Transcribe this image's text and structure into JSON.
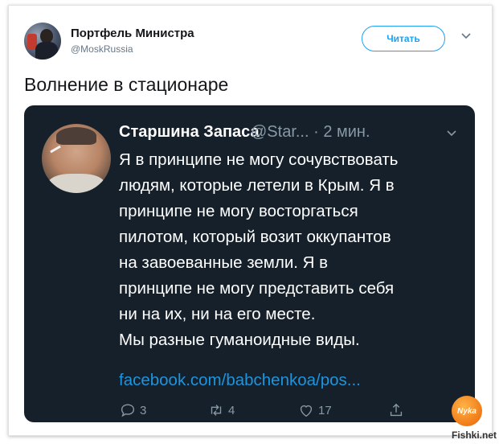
{
  "header": {
    "name": "Портфель Министра",
    "handle": "@MoskRussia",
    "follow_label": "Читать"
  },
  "tweet": {
    "text": "Волнение в стационаре"
  },
  "screenshot": {
    "name": "Старшина Запаса",
    "meta": "@Star... · 2 мин.",
    "body_lines": [
      "Я в принципе не могу сочувствовать",
      "людям, которые летели в Крым. Я в",
      "принципе не могу восторгаться",
      "пилотом, который возит оккупантов",
      "на завоеванные земли. Я в",
      "принципе не могу представить себя",
      "ни на их, ни на его месте.",
      "Мы разные гуманоидные виды."
    ],
    "link": "facebook.com/babchenkoa/pos...",
    "actions": {
      "reply_count": "3",
      "retweet_count": "4",
      "like_count": "17",
      "reply_icon": "reply-icon",
      "retweet_icon": "retweet-icon",
      "like_icon": "heart-icon",
      "share_icon": "share-icon"
    },
    "colors": {
      "background": "#15202b",
      "link": "#1b95e0",
      "muted": "#8899a6"
    }
  },
  "badge": {
    "text": "Nyka"
  },
  "watermark": "Fishki.net",
  "colors": {
    "accent": "#1da1f2"
  }
}
